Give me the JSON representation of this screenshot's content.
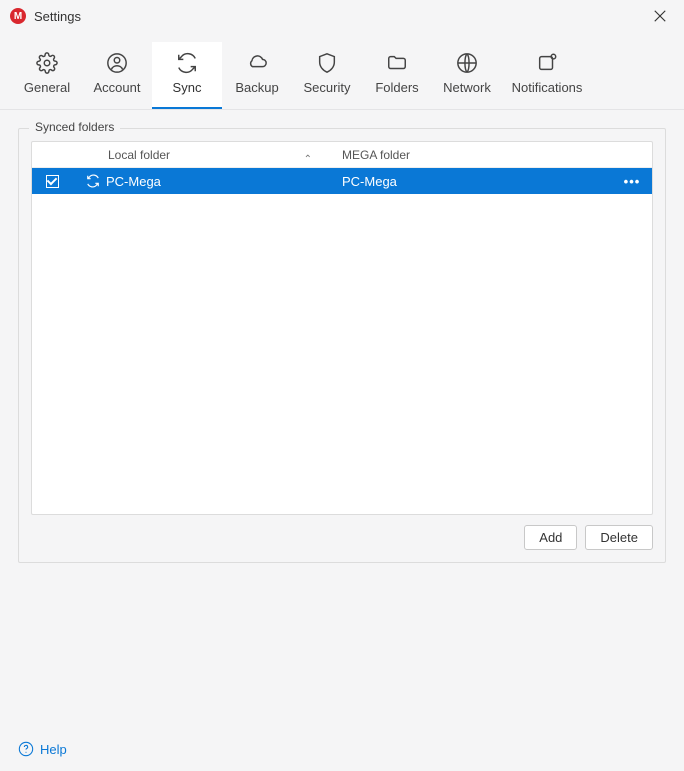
{
  "window": {
    "title": "Settings",
    "app_icon_letter": "M"
  },
  "tabs": {
    "general": "General",
    "account": "Account",
    "sync": "Sync",
    "backup": "Backup",
    "security": "Security",
    "folders": "Folders",
    "network": "Network",
    "notifications": "Notifications",
    "active": "sync"
  },
  "sync": {
    "section_label": "Synced folders",
    "columns": {
      "local": "Local folder",
      "mega": "MEGA folder"
    },
    "rows": [
      {
        "checked": true,
        "local": "PC-Mega",
        "mega": "PC-Mega"
      }
    ],
    "buttons": {
      "add": "Add",
      "delete": "Delete"
    }
  },
  "footer": {
    "help": "Help"
  },
  "colors": {
    "accent": "#0a78d6",
    "brand": "#d9272e"
  }
}
